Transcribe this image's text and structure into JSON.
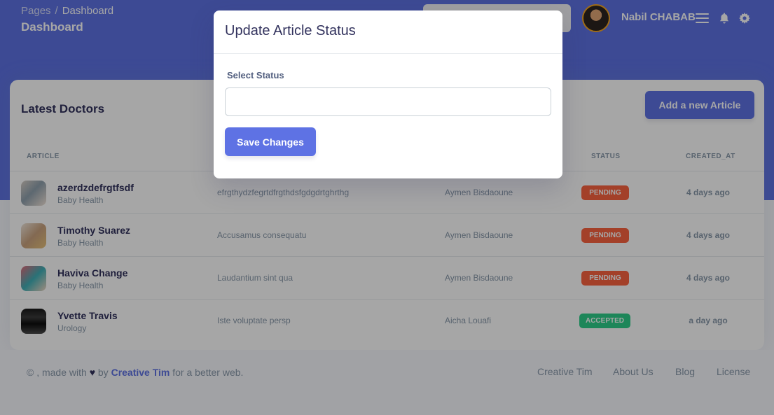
{
  "header": {
    "breadcrumb": [
      "Pages",
      "Dashboard"
    ],
    "breadcrumb_sep": "/",
    "page_title": "Dashboard",
    "user_name": "Nabil CHABAB"
  },
  "table": {
    "title": "Latest Doctors",
    "add_button": "Add a new Article",
    "columns": [
      "ARTICLE",
      "STATUS",
      "CREATED_AT"
    ],
    "rows": [
      {
        "name": "azerdzdefrgtfsdf",
        "category": "Baby Health",
        "description": "efrgthydzfegrtdfrgthdsfgdgdrtghrthg",
        "author": "Aymen Bisdaoune",
        "status": "PENDING",
        "created": "4 days ago"
      },
      {
        "name": "Timothy Suarez",
        "category": "Baby Health",
        "description": "Accusamus consequatu",
        "author": "Aymen Bisdaoune",
        "status": "PENDING",
        "created": "4 days ago"
      },
      {
        "name": "Haviva Change",
        "category": "Baby Health",
        "description": "Laudantium sint qua",
        "author": "Aymen Bisdaoune",
        "status": "PENDING",
        "created": "4 days ago"
      },
      {
        "name": "Yvette Travis",
        "category": "Urology",
        "description": "Iste voluptate persp",
        "author": "Aicha Louafi",
        "status": "ACCEPTED",
        "created": "a day ago"
      }
    ]
  },
  "footer": {
    "copyright_prefix": "© , made with",
    "copyright_by": "by",
    "brand": "Creative Tim",
    "copyright_suffix": "for a better web.",
    "links": [
      "Creative Tim",
      "About Us",
      "Blog",
      "License"
    ]
  },
  "modal": {
    "title": "Update Article Status",
    "status_label": "Select Status",
    "status_value": "",
    "save_button": "Save Changes"
  },
  "colors": {
    "primary": "#5e72e4",
    "pending": "#fb6340",
    "accepted": "#2dce89"
  }
}
